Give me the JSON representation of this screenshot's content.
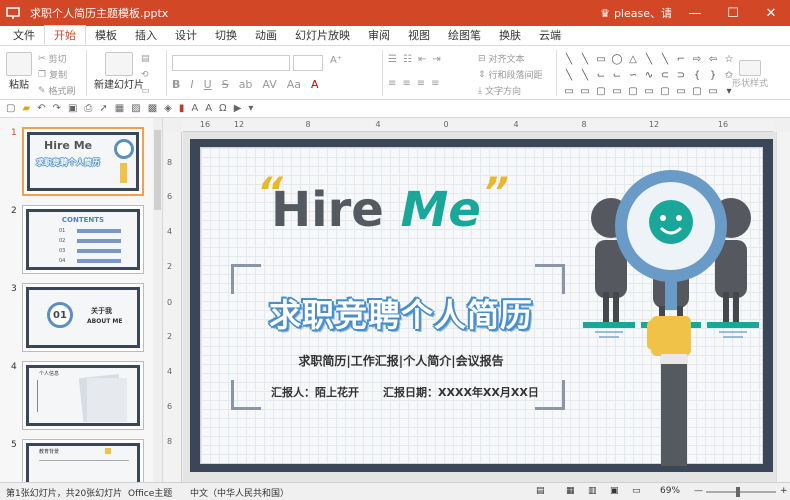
{
  "window": {
    "doc_title": "求职个人简历主题模板.pptx",
    "user_name": "please、请",
    "min_icon": "minimize-icon",
    "max_icon": "maximize-icon",
    "close_icon": "close-icon"
  },
  "menu": {
    "tabs": [
      "文件",
      "开始",
      "模板",
      "插入",
      "设计",
      "切换",
      "动画",
      "幻灯片放映",
      "审阅",
      "视图",
      "绘图笔",
      "换肤",
      "云端"
    ],
    "active": "开始"
  },
  "ribbon": {
    "paste": "粘贴",
    "cut": "剪切",
    "copy": "复制",
    "format_painter": "格式刷",
    "new_slide": "新建幻灯片",
    "font_bold": "B",
    "font_italic": "I",
    "font_underline": "U",
    "font_strike": "S",
    "align_text": "对齐文本",
    "line_spacing": "行和段落间距",
    "text_direction": "文字方向",
    "shape_style": "形状样式"
  },
  "ruler": {
    "h_ticks": [
      "16",
      "12",
      "8",
      "4",
      "0",
      "4",
      "8",
      "12",
      "16"
    ],
    "v_ticks": [
      "8",
      "6",
      "4",
      "2",
      "0",
      "2",
      "4",
      "6",
      "8"
    ]
  },
  "thumbnails": [
    {
      "num": "1",
      "title": "Hire Me",
      "sub": "求职竞聘个人简历"
    },
    {
      "num": "2",
      "title": "CONTENTS",
      "items": [
        "01",
        "02",
        "03",
        "04"
      ]
    },
    {
      "num": "3",
      "badge": "01",
      "title": "关于我",
      "sub": "ABOUT  ME"
    },
    {
      "num": "4",
      "title": "个人信息"
    },
    {
      "num": "5",
      "title": "教育背景"
    }
  ],
  "slide": {
    "hire_word": "Hire",
    "me_word": "Me",
    "open_quote": "“",
    "close_quote": "”",
    "main_title": "求职竞聘个人简历",
    "subtitle": "求职简历|工作汇报|个人简介|会议报告",
    "reporter": "汇报人：陌上花开",
    "report_date": "汇报日期：XXXX年XX月XX日"
  },
  "status": {
    "slide_info": "第1张幻灯片，共20张幻灯片",
    "theme": "Office主题",
    "language": "中文（中华人民共和国）",
    "zoom": "69%",
    "zoom_level": 0.69
  },
  "colors": {
    "brand": "#d24726",
    "teal": "#1aa79a",
    "slide_frame": "#3b4656",
    "title_blue": "#4b8fc9",
    "quote_gold": "#e6b830"
  }
}
